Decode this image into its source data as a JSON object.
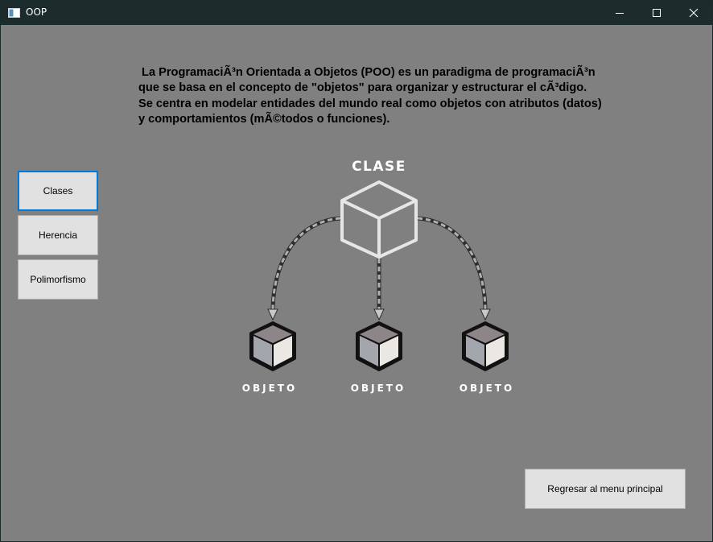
{
  "window": {
    "title": "OOP",
    "icon": "app-window-icon",
    "controls": [
      "minimize-icon",
      "maximize-icon",
      "close-icon"
    ]
  },
  "description": {
    "lines": [
      " La ProgramaciÃ³n Orientada a Objetos (POO) es un paradigma de programaciÃ³n",
      "que se basa en el concepto de \"objetos\" para organizar y estructurar el cÃ³digo.",
      "Se centra en modelar entidades del mundo real como objetos con atributos (datos)",
      "y comportamientos (mÃ©todos o funciones)."
    ]
  },
  "sidebar": {
    "items": [
      {
        "label": "Clases",
        "selected": true
      },
      {
        "label": "Herencia",
        "selected": false
      },
      {
        "label": "Polimorfismo",
        "selected": false
      }
    ]
  },
  "diagram": {
    "class_label": "CLASE",
    "object_labels": [
      "OBJETO",
      "OBJETO",
      "OBJETO"
    ]
  },
  "footer": {
    "back_label": "Regresar al menu principal"
  },
  "colors": {
    "background": "#808080",
    "titlebar": "#1c2b2b",
    "button": "#e1e1e1",
    "focus": "#0078d7"
  }
}
